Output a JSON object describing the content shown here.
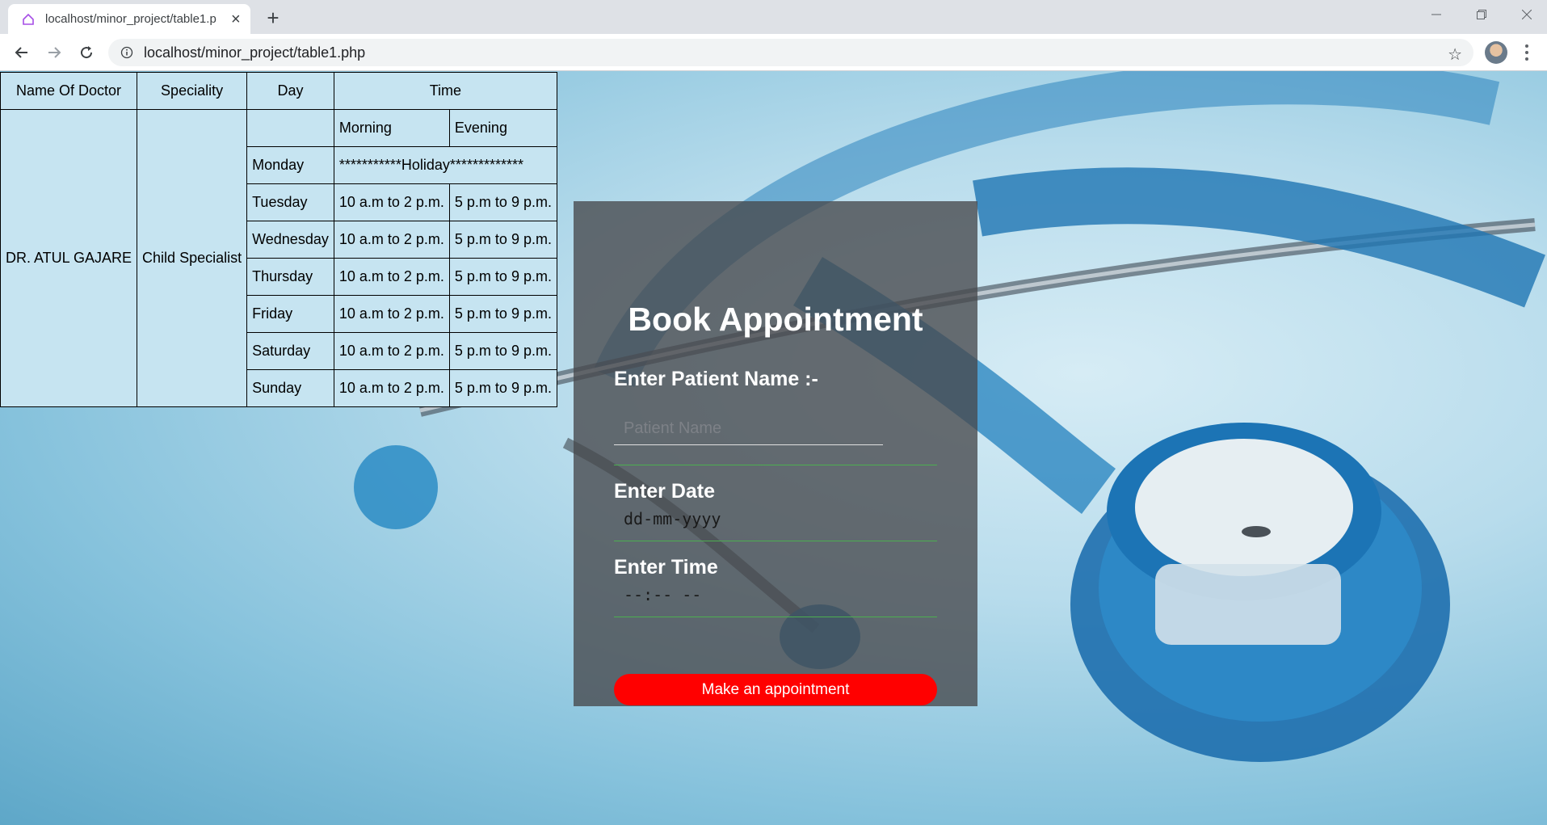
{
  "browser": {
    "tab_title": "localhost/minor_project/table1.p",
    "url": "localhost/minor_project/table1.php"
  },
  "schedule": {
    "headers": {
      "doctor": "Name Of Doctor",
      "speciality": "Speciality",
      "day": "Day",
      "time": "Time",
      "morning": "Morning",
      "evening": "Evening"
    },
    "doctor_name": "DR. ATUL GAJARE",
    "speciality": "Child Specialist",
    "holiday_day": "Monday",
    "holiday_text": "***********Holiday*************",
    "rows": [
      {
        "day": "Tuesday",
        "morning": "10 a.m to 2 p.m.",
        "evening": "5 p.m to 9 p.m."
      },
      {
        "day": "Wednesday",
        "morning": "10 a.m to 2 p.m.",
        "evening": "5 p.m to 9 p.m."
      },
      {
        "day": "Thursday",
        "morning": "10 a.m to 2 p.m.",
        "evening": "5 p.m to 9 p.m."
      },
      {
        "day": "Friday",
        "morning": "10 a.m to 2 p.m.",
        "evening": "5 p.m to 9 p.m."
      },
      {
        "day": "Saturday",
        "morning": "10 a.m to 2 p.m.",
        "evening": "5 p.m to 9 p.m."
      },
      {
        "day": "Sunday",
        "morning": "10 a.m to 2 p.m.",
        "evening": "5 p.m to 9 p.m."
      }
    ]
  },
  "form": {
    "title": "Book Appointment",
    "name_label": "Enter Patient Name :-",
    "name_placeholder": "Patient Name",
    "date_label": "Enter Date",
    "date_placeholder": "dd-mm-yyyy",
    "time_label": "Enter Time",
    "time_placeholder": "--:-- --",
    "submit_label": "Make an appointment",
    "submit_color": "#ff0000",
    "underline_color": "#4caf50"
  }
}
